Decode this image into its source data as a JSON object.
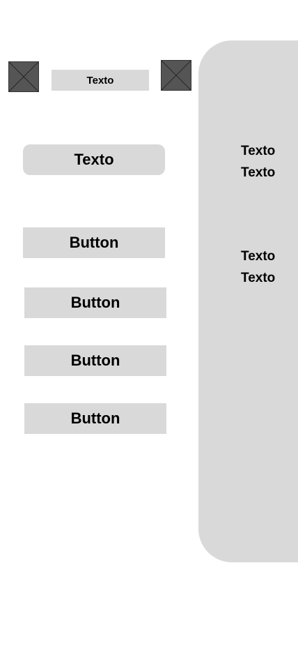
{
  "header": {
    "label": "Texto",
    "left_image_icon": "image-placeholder-icon",
    "right_image_icon": "image-placeholder-icon"
  },
  "main": {
    "title": "Texto",
    "buttons": [
      {
        "label": "Button"
      },
      {
        "label": "Button"
      },
      {
        "label": "Button"
      },
      {
        "label": "Button"
      }
    ]
  },
  "side_panel": {
    "group1": [
      "Texto",
      "Texto"
    ],
    "group2": [
      "Texto",
      "Texto"
    ]
  },
  "colors": {
    "placeholder": "#555555",
    "surface": "#d9d9d9",
    "text": "#000000",
    "background": "#ffffff"
  }
}
